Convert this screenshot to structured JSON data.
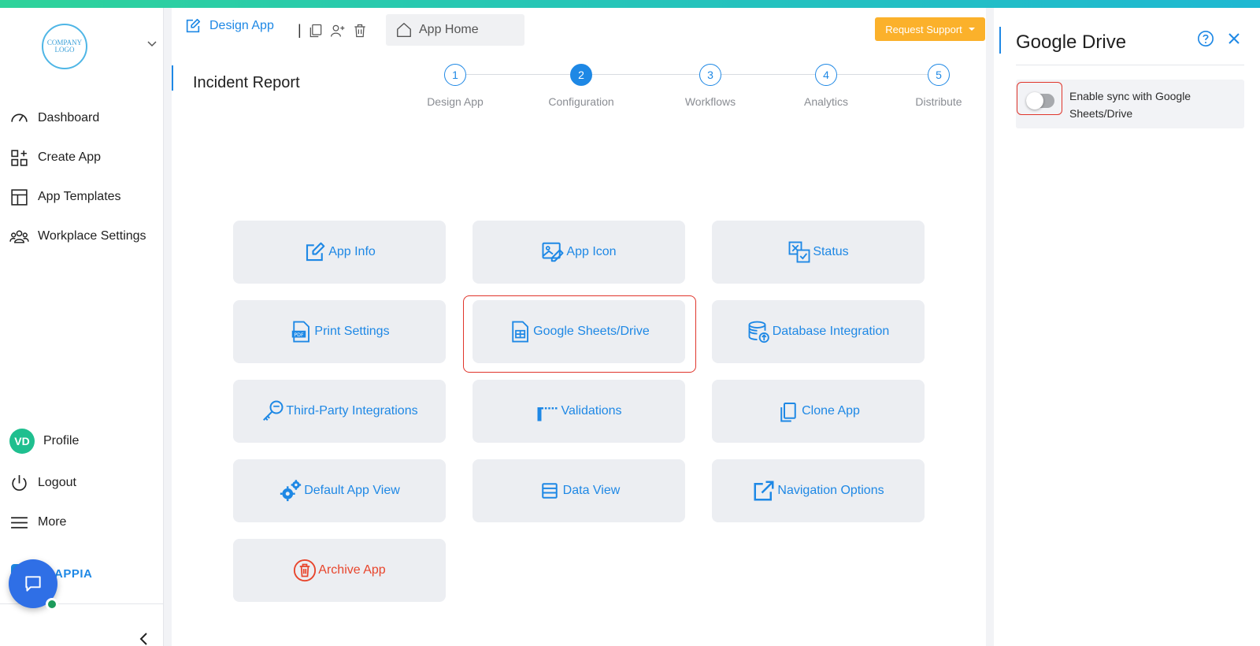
{
  "colors": {
    "accent": "#1e88e5",
    "warning": "#fbb12b",
    "danger": "#e8452c",
    "success": "#1fbf8f"
  },
  "sidebar": {
    "logo_text": "COMPANY LOGO",
    "items": [
      {
        "label": "Dashboard",
        "icon": "gauge-icon"
      },
      {
        "label": "Create App",
        "icon": "grid-plus-icon"
      },
      {
        "label": "App Templates",
        "icon": "template-icon"
      },
      {
        "label": "Workplace Settings",
        "icon": "users-icon"
      }
    ],
    "profile": {
      "initials": "VD",
      "label": "Profile"
    },
    "logout_label": "Logout",
    "more_label": "More",
    "brand": "CLAPPIA"
  },
  "header": {
    "design_tab": "Design App",
    "separator": "|",
    "home_tab": "App Home",
    "request_support": "Request Support"
  },
  "page": {
    "title": "Incident Report"
  },
  "stepper": {
    "active": 2,
    "steps": [
      {
        "num": "1",
        "label": "Design App"
      },
      {
        "num": "2",
        "label": "Configuration"
      },
      {
        "num": "3",
        "label": "Workflows"
      },
      {
        "num": "4",
        "label": "Analytics"
      },
      {
        "num": "5",
        "label": "Distribute"
      }
    ]
  },
  "cards": [
    {
      "label": "App Info",
      "icon": "edit-icon"
    },
    {
      "label": "App Icon",
      "icon": "image-edit-icon"
    },
    {
      "label": "Status",
      "icon": "status-icon"
    },
    {
      "label": "Print Settings",
      "icon": "pdf-icon"
    },
    {
      "label": "Google Sheets/Drive",
      "icon": "sheet-icon"
    },
    {
      "label": "Database Integration",
      "icon": "database-icon"
    },
    {
      "label": "Third-Party Integrations",
      "icon": "key-icon"
    },
    {
      "label": "Validations",
      "icon": "barrier-icon"
    },
    {
      "label": "Clone App",
      "icon": "copy-icon"
    },
    {
      "label": "Default App View",
      "icon": "gears-icon"
    },
    {
      "label": "Data View",
      "icon": "list-icon"
    },
    {
      "label": "Navigation Options",
      "icon": "external-link-icon"
    },
    {
      "label": "Archive App",
      "icon": "trash-icon"
    }
  ],
  "panel": {
    "title": "Google Drive",
    "sync_label": "Enable sync with Google Sheets/Drive",
    "sync_enabled": false
  }
}
